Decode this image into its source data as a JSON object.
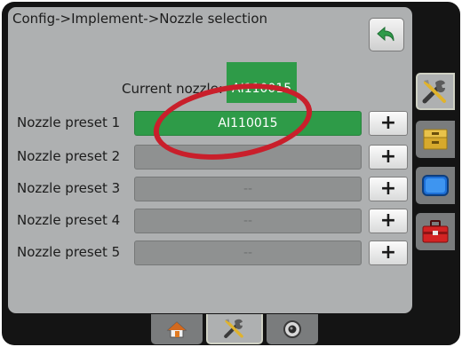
{
  "header": {
    "breadcrumb": "Config->Implement->Nozzle selection"
  },
  "current": {
    "label": "Current nozzle:",
    "value": "AI110015"
  },
  "presets": [
    {
      "label": "Nozzle preset 1",
      "value": "AI110015",
      "active": true
    },
    {
      "label": "Nozzle preset 2",
      "value": "",
      "active": false
    },
    {
      "label": "Nozzle preset 3",
      "value": "--",
      "active": false
    },
    {
      "label": "Nozzle preset 4",
      "value": "--",
      "active": false
    },
    {
      "label": "Nozzle preset 5",
      "value": "--",
      "active": false
    }
  ],
  "buttons": {
    "plus_label": "+"
  },
  "side_tabs": [
    "tools-icon",
    "drawer-box-icon",
    "display-icon",
    "toolbox-icon"
  ],
  "bottom_tabs": [
    "home-icon",
    "tools-icon",
    "camera-icon"
  ],
  "colors": {
    "active_green": "#2e9b48",
    "annotation_red": "#c91f2b",
    "panel_gray": "#aeb0b1",
    "frame_dark": "#141414"
  }
}
